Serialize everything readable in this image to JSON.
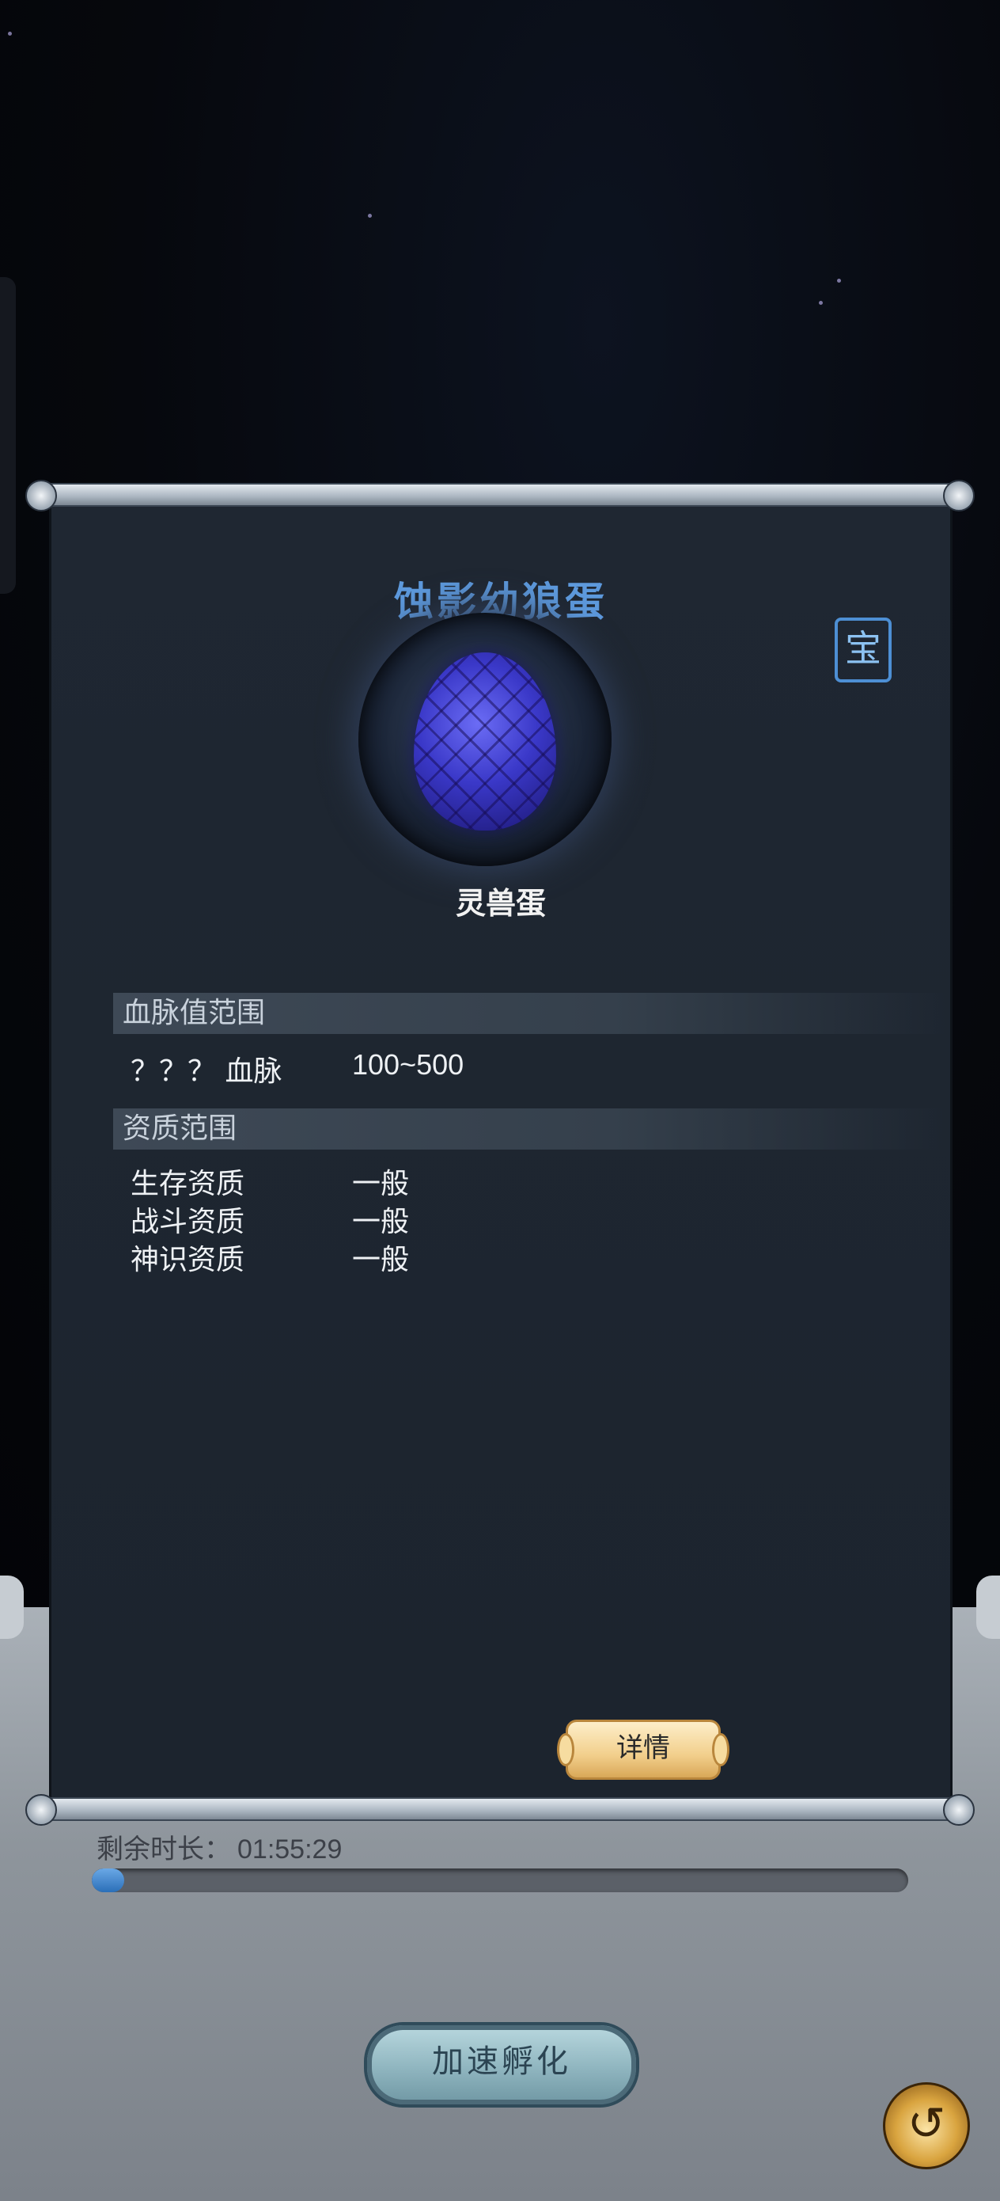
{
  "egg": {
    "name": "蚀影幼狼蛋",
    "seal_glyph": "宝",
    "type_label": "灵兽蛋"
  },
  "bloodline": {
    "section_title": "血脉值范围",
    "rows": [
      {
        "label": "？？？ 血脉",
        "value": "100~500"
      }
    ]
  },
  "aptitude": {
    "section_title": "资质范围",
    "rows": [
      {
        "label": "生存资质",
        "value": "一般"
      },
      {
        "label": "战斗资质",
        "value": "一般"
      },
      {
        "label": "神识资质",
        "value": "一般"
      }
    ]
  },
  "details_button": {
    "label": "详情"
  },
  "hatch": {
    "remaining_label": "剩余时长：",
    "remaining_time": "01:55:29",
    "progress": 0.04,
    "speed_button_label": "加速孵化"
  },
  "back_button": {
    "icon": "swirl-return-icon"
  },
  "colors": {
    "title": "#5d99dc",
    "panel": "#1f2732",
    "progress_fill": "#2b6fb8",
    "details_button": "#f2cf8c"
  }
}
